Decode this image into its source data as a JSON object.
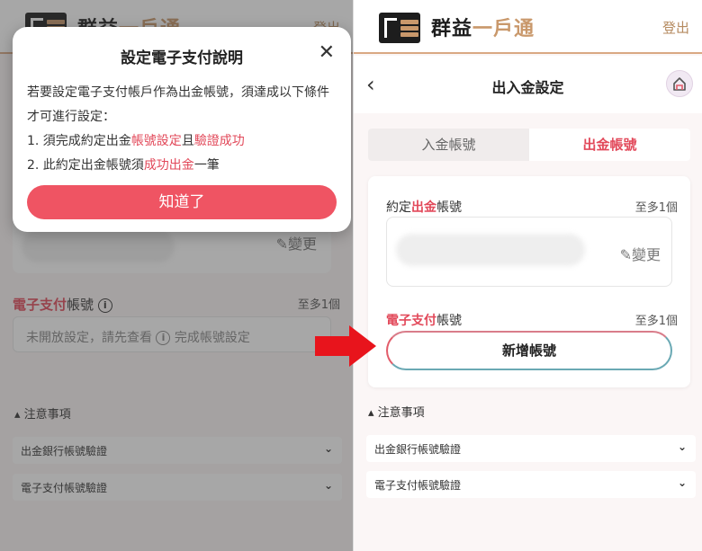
{
  "header": {
    "brand_black": "群益",
    "brand_gold": "一戶通",
    "logout": "登出"
  },
  "left": {
    "change_label": "變更",
    "esp": {
      "label_red": "電子支付",
      "label_rest": "帳號",
      "limit": "至多1個",
      "hint_prefix": "未開放設定，請先查看",
      "hint_suffix": "完成帳號設定"
    },
    "notes": {
      "title": "注意事項",
      "items": [
        "出金銀行帳號驗證",
        "電子支付帳號驗證"
      ]
    },
    "modal": {
      "title": "設定電子支付說明",
      "intro": "若要設定電子支付帳戶作為出金帳號，須達成以下條件才可進行設定：",
      "line1_a": "1. 須完成約定出金",
      "line1_b": "帳號設定",
      "line1_c": "且",
      "line1_d": "驗證成功",
      "line2_a": "2. 此約定出金帳號須",
      "line2_b": "成功出金",
      "line2_c": "一筆",
      "button": "知道了"
    }
  },
  "right": {
    "title": "出入金設定",
    "tabs": [
      "入金帳號",
      "出金帳號"
    ],
    "active_tab": 1,
    "withdraw": {
      "label_a": "約定",
      "label_red": "出金",
      "label_b": "帳號",
      "limit": "至多1個",
      "change": "變更"
    },
    "esp": {
      "label_red": "電子支付",
      "label_rest": "帳號",
      "limit": "至多1個",
      "add_button": "新增帳號"
    },
    "notes": {
      "title": "注意事項",
      "items": [
        "出金銀行帳號驗證",
        "電子支付帳號驗證"
      ]
    }
  },
  "colors": {
    "accent_red": "#e2495a",
    "brand_gold": "#c9986b",
    "arrow_red": "#e8141c"
  },
  "icons": [
    "close-icon",
    "back-chevron-icon",
    "home-icon",
    "pencil-icon",
    "info-icon",
    "chevron-up-icon",
    "chevron-down-icon",
    "arrow-right-icon"
  ]
}
